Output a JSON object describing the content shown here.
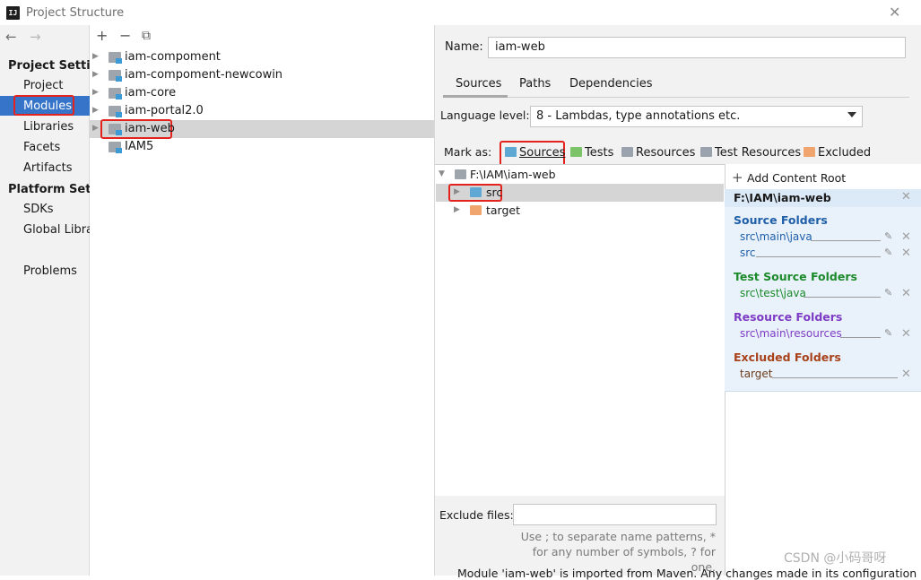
{
  "window": {
    "title": "Project Structure",
    "app_icon": "IJ"
  },
  "nav": {
    "back_icon": "←",
    "forward_icon": "→"
  },
  "sidebar": {
    "project_settings_header": "Project Settings",
    "items_project": [
      {
        "label": "Project"
      },
      {
        "label": "Modules"
      },
      {
        "label": "Libraries"
      },
      {
        "label": "Facets"
      },
      {
        "label": "Artifacts"
      }
    ],
    "platform_settings_header": "Platform Settings",
    "items_platform": [
      {
        "label": "SDKs"
      },
      {
        "label": "Global Libraries"
      }
    ],
    "problems_label": "Problems"
  },
  "modules_toolbar": {
    "add": "+",
    "remove": "−",
    "copy": "⧉"
  },
  "modules": [
    {
      "name": "iam-compoment"
    },
    {
      "name": "iam-compoment-newcowin"
    },
    {
      "name": "iam-core"
    },
    {
      "name": "iam-portal2.0"
    },
    {
      "name": "iam-web"
    },
    {
      "name": "IAM5"
    }
  ],
  "module_settings": {
    "name_label": "Name:",
    "name_value": "iam-web",
    "tabs": [
      {
        "label": "Sources"
      },
      {
        "label": "Paths"
      },
      {
        "label": "Dependencies"
      }
    ],
    "language_level_label": "Language level:",
    "language_level_value": "8 - Lambdas, type annotations etc.",
    "mark_as_label": "Mark as:",
    "mark_as_buttons": [
      {
        "label": "Sources",
        "color": "#5fa8d3"
      },
      {
        "label": "Tests",
        "color": "#7cc36a"
      },
      {
        "label": "Resources",
        "color": "#9aa3ad"
      },
      {
        "label": "Test Resources",
        "color": "#9aa3ad"
      },
      {
        "label": "Excluded",
        "color": "#f0a46e"
      }
    ],
    "tree": {
      "root": "F:\\IAM\\iam-web",
      "children": [
        {
          "name": "src"
        },
        {
          "name": "target"
        }
      ]
    },
    "add_content_root": "Add Content Root",
    "content_root": "F:\\IAM\\iam-web",
    "folder_groups": [
      {
        "title": "Source Folders",
        "color": "#1f5fa8",
        "paths": [
          "src\\main\\java",
          "src"
        ]
      },
      {
        "title": "Test Source Folders",
        "color": "#1b8a2a",
        "paths": [
          "src\\test\\java"
        ]
      },
      {
        "title": "Resource Folders",
        "color": "#7e3cc5",
        "paths": [
          "src\\main\\resources"
        ]
      },
      {
        "title": "Excluded Folders",
        "color": "#a8421a",
        "paths": [
          "target"
        ]
      }
    ],
    "exclude_files_label": "Exclude files:",
    "exclude_files_hint": "Use ; to separate name patterns, * for any number of symbols, ? for one.",
    "bottom_note": "Module 'iam-web' is imported from Maven. Any changes made in its configuration"
  },
  "watermark": "CSDN @小码哥呀"
}
